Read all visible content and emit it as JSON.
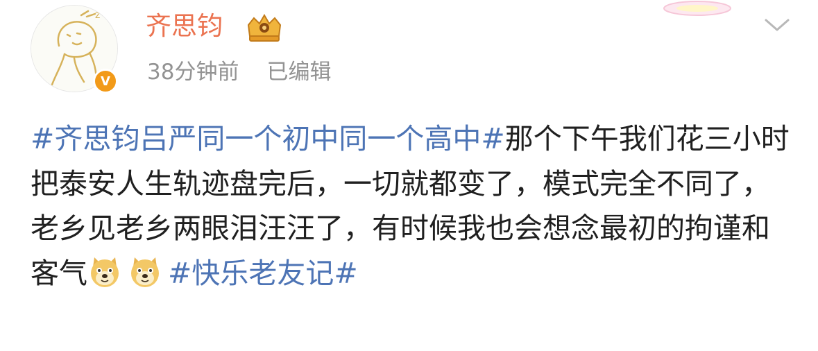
{
  "user": {
    "name": "齐思钧",
    "time": "38分钟前",
    "edited": "已编辑"
  },
  "post": {
    "hashtag1": "#齐思钧吕严同一个初中同一个高中#",
    "body1": "那个下午我们花三小时把泰安人生轨迹盘完后，一切就都变了，模式完全不同了，老乡见老乡两眼泪汪汪了，有时候我也会想念最初的拘谨和客气",
    "hashtag2": "#快乐老友记#"
  },
  "icons": {
    "avatar": "sketch-avatar",
    "verified": "verified-v-badge",
    "member": "crown-badge-icon",
    "more": "chevron-down-icon",
    "emoji": "doge-emoji-icon"
  },
  "colors": {
    "username": "#eb7350",
    "hashtag": "#4d74b5",
    "meta": "#939393",
    "text": "#202020",
    "verified": "#f29a18"
  }
}
